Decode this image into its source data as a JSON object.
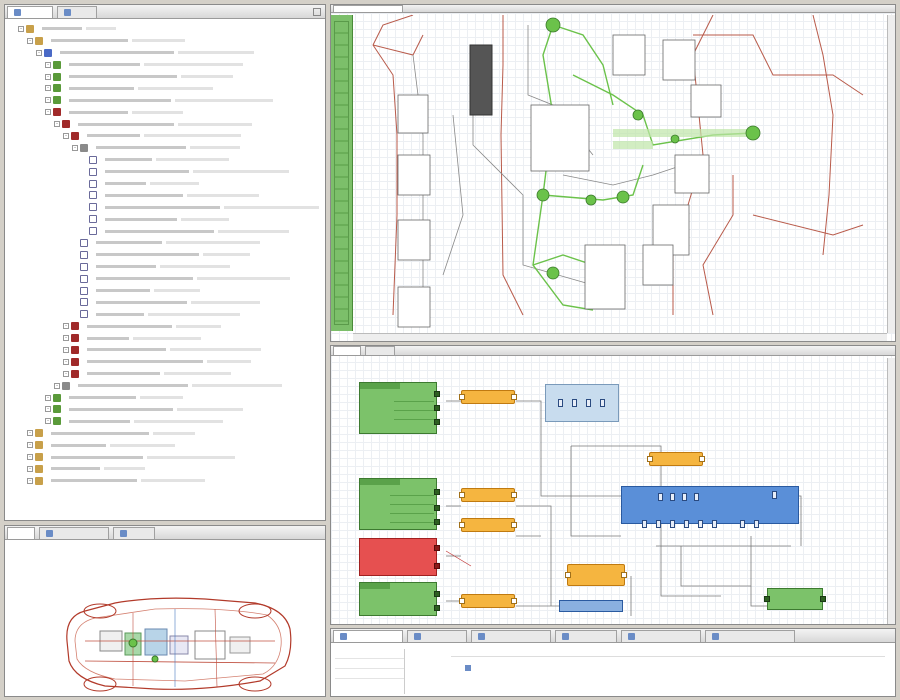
{
  "workspace": {
    "outline_tabs": [
      {
        "label": "",
        "active": true
      },
      {
        "label": "",
        "active": false
      }
    ],
    "editor_tabs_top": [
      {
        "label": "",
        "active": true
      }
    ],
    "editor_tabs_mid": [
      {
        "label": "",
        "active": true
      },
      {
        "label": "",
        "active": false
      }
    ],
    "bottom_left_tabs": [
      {
        "label": "",
        "active": true
      },
      {
        "label": "",
        "active": false
      },
      {
        "label": "",
        "active": false
      }
    ],
    "bottom_right_tabs": [
      {
        "label": "",
        "active": true
      },
      {
        "label": "",
        "active": false
      },
      {
        "label": "",
        "active": false
      },
      {
        "label": "",
        "active": false
      },
      {
        "label": "",
        "active": false
      },
      {
        "label": "",
        "active": false
      }
    ]
  },
  "tree": {
    "rows": [
      {
        "indent": 1,
        "icon": "folder",
        "label": "",
        "meta": ""
      },
      {
        "indent": 2,
        "icon": "folder",
        "label": "",
        "meta": ""
      },
      {
        "indent": 3,
        "icon": "blue",
        "label": "",
        "meta": ""
      },
      {
        "indent": 4,
        "icon": "green",
        "label": "",
        "meta": ""
      },
      {
        "indent": 4,
        "icon": "green",
        "label": "",
        "meta": ""
      },
      {
        "indent": 4,
        "icon": "green",
        "label": "",
        "meta": ""
      },
      {
        "indent": 4,
        "icon": "green",
        "label": "",
        "meta": ""
      },
      {
        "indent": 4,
        "icon": "red",
        "label": "",
        "meta": ""
      },
      {
        "indent": 5,
        "icon": "red",
        "label": "",
        "meta": ""
      },
      {
        "indent": 6,
        "icon": "red",
        "label": "",
        "meta": ""
      },
      {
        "indent": 7,
        "icon": "grey",
        "label": "",
        "meta": ""
      },
      {
        "indent": 8,
        "icon": "port",
        "label": "",
        "meta": ""
      },
      {
        "indent": 8,
        "icon": "port",
        "label": "",
        "meta": ""
      },
      {
        "indent": 8,
        "icon": "port",
        "label": "",
        "meta": ""
      },
      {
        "indent": 8,
        "icon": "port",
        "label": "",
        "meta": ""
      },
      {
        "indent": 8,
        "icon": "port",
        "label": "",
        "meta": ""
      },
      {
        "indent": 8,
        "icon": "port",
        "label": "",
        "meta": ""
      },
      {
        "indent": 8,
        "icon": "port",
        "label": "",
        "meta": ""
      },
      {
        "indent": 7,
        "icon": "port",
        "label": "",
        "meta": ""
      },
      {
        "indent": 7,
        "icon": "port",
        "label": "",
        "meta": ""
      },
      {
        "indent": 7,
        "icon": "port",
        "label": "",
        "meta": ""
      },
      {
        "indent": 7,
        "icon": "port",
        "label": "",
        "meta": ""
      },
      {
        "indent": 7,
        "icon": "port",
        "label": "",
        "meta": ""
      },
      {
        "indent": 7,
        "icon": "port",
        "label": "",
        "meta": ""
      },
      {
        "indent": 7,
        "icon": "port",
        "label": "",
        "meta": ""
      },
      {
        "indent": 6,
        "icon": "red",
        "label": "",
        "meta": ""
      },
      {
        "indent": 6,
        "icon": "red",
        "label": "",
        "meta": ""
      },
      {
        "indent": 6,
        "icon": "red",
        "label": "",
        "meta": ""
      },
      {
        "indent": 6,
        "icon": "red",
        "label": "",
        "meta": ""
      },
      {
        "indent": 6,
        "icon": "red",
        "label": "",
        "meta": ""
      },
      {
        "indent": 5,
        "icon": "grey",
        "label": "",
        "meta": ""
      },
      {
        "indent": 4,
        "icon": "green",
        "label": "",
        "meta": ""
      },
      {
        "indent": 4,
        "icon": "green",
        "label": "",
        "meta": ""
      },
      {
        "indent": 4,
        "icon": "green",
        "label": "",
        "meta": ""
      },
      {
        "indent": 2,
        "icon": "folder",
        "label": "",
        "meta": ""
      },
      {
        "indent": 2,
        "icon": "folder",
        "label": "",
        "meta": ""
      },
      {
        "indent": 2,
        "icon": "folder",
        "label": "",
        "meta": ""
      },
      {
        "indent": 2,
        "icon": "folder",
        "label": "",
        "meta": ""
      },
      {
        "indent": 2,
        "icon": "folder",
        "label": "",
        "meta": ""
      }
    ]
  },
  "colors": {
    "ecu_green": "#7cc26a",
    "ecu_red": "#e65050",
    "signal_orange": "#f5b540",
    "gateway_blue": "#5a8fd8",
    "bus_light_blue": "#c8dcee",
    "node_green": "#6bc24a"
  },
  "properties": {
    "rows": [
      {
        "key": "",
        "value": ""
      },
      {
        "key": "",
        "value": ""
      },
      {
        "key": "",
        "value": ""
      }
    ],
    "selection": ""
  }
}
